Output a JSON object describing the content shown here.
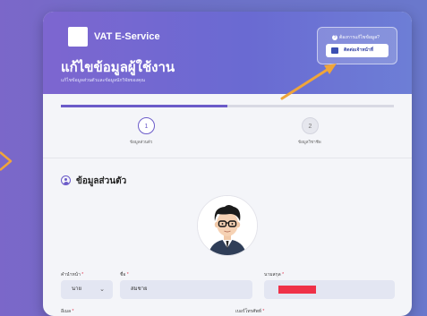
{
  "header": {
    "brand": "VAT E-Service",
    "title": "แก้ไขข้อมูลผู้ใช้งาน",
    "subtitle": "แก้ไขข้อมูลส่วนตัวและข้อมูลนักวิจัยของคุณ",
    "help_text": "ต้องการแก้ไขข้อมูล?",
    "contact_button": "ติดต่อเจ้าหน้าที่"
  },
  "progress": {
    "current_step": 1,
    "total_steps": 2,
    "fill_fraction": 0.5
  },
  "steps": [
    {
      "number": "1",
      "label": "ข้อมูลส่วนตัว",
      "active": true
    },
    {
      "number": "2",
      "label": "ข้อมูลวิชาชีพ",
      "active": false
    }
  ],
  "section": {
    "title": "ข้อมูลส่วนตัว"
  },
  "form": {
    "prefix": {
      "label": "คำนำหน้า",
      "value": "นาย"
    },
    "first_name": {
      "label": "ชื่อ",
      "value": "สมชาย"
    },
    "last_name": {
      "label": "นามสกุล",
      "value": ""
    },
    "email": {
      "label": "อีเมล"
    },
    "phone": {
      "label": "เบอร์โทรศัพท์"
    },
    "required_marker": "*"
  },
  "colors": {
    "accent": "#6b5bc9",
    "annotation_arrow": "#f0a53a",
    "redaction": "#ef3148"
  },
  "icons": [
    "logo-box",
    "help-circle-icon",
    "contact-icon",
    "user-circle-icon",
    "chevron-down-icon",
    "avatar-illustration"
  ]
}
